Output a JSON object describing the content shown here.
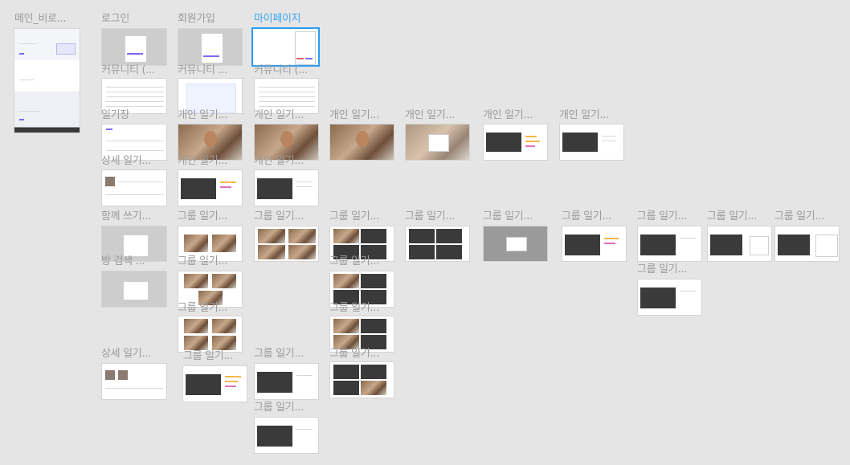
{
  "canvas": {
    "labels": {
      "main": "메인_비로...",
      "login": "로그인",
      "signup": "회원가입",
      "mypage": "마이페이지",
      "community1": "커뮤니티 (...",
      "community2": "커뮤니티 ...",
      "community3": "커뮤니티 (...",
      "diary": "일기장",
      "personal1": "개인 일기...",
      "personal2": "개인 일기...",
      "personal3": "개인 일기...",
      "personal4": "개인 일기...",
      "personal5": "개인 일기...",
      "personal6": "개인 일기...",
      "detail1": "상세 일기...",
      "personal7": "개인 일기...",
      "personal8": "개인 일기...",
      "together": "함께 쓰기...",
      "group1": "그룹 일기...",
      "group2": "그룹 일기...",
      "group3": "그룹 일기...",
      "group4": "그룹 일기...",
      "group5": "그룹 일기...",
      "group6": "그룹 일기...",
      "group7": "그룹 일기...",
      "group8": "그룹 일기...",
      "group9": "그룹 일기...",
      "group10": "그룹 일기...",
      "roomsearch": "방 검색 ...",
      "group11": "그룹 일기...",
      "group12": "그룹 일기...",
      "group13": "그룹 일기...",
      "group14": "그룹 일기...",
      "detail2": "상세 일기...",
      "group15": "그룹 일기...",
      "group16": "그룹 일기...",
      "group17": "그룹 일기...",
      "group18": "그룹 일기..."
    }
  }
}
